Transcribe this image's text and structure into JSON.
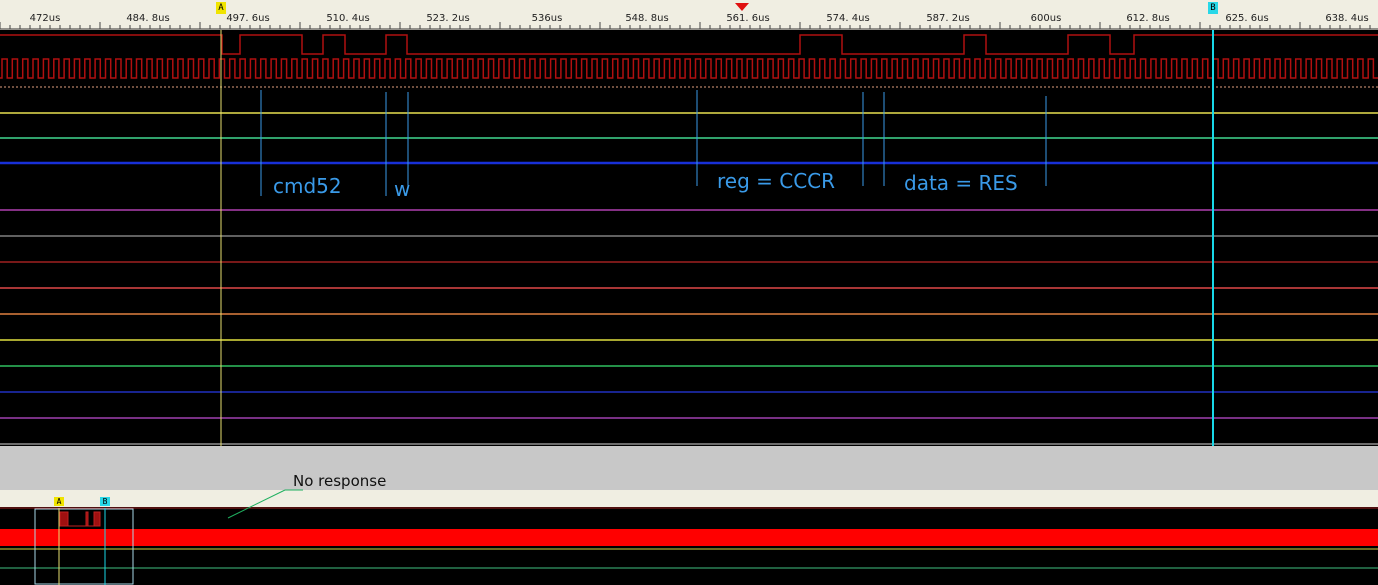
{
  "ruler": {
    "ticks": [
      "472us",
      "484. 8us",
      "497. 6us",
      "510. 4us",
      "523. 2us",
      "536us",
      "548. 8us",
      "561. 6us",
      "574. 4us",
      "587. 2us",
      "600us",
      "612. 8us",
      "625. 6us",
      "638. 4us"
    ]
  },
  "markers": {
    "a_label": "A",
    "b_label": "B"
  },
  "annotations": {
    "cmd": "cmd52",
    "rw": "w",
    "reg": "reg = CCCR",
    "data": "data = RES"
  },
  "callout": {
    "text": "No response"
  },
  "colors": {
    "cursor_a": "#e8e070",
    "cursor_b": "#18d8e8",
    "signal_red": "#b01010",
    "annotation_blue": "#3a9ae8",
    "channel_lines": [
      "#e8e050",
      "#40d890",
      "#1020c8",
      "#b040b0",
      "#808080",
      "#a02020",
      "#e04848",
      "#e08040",
      "#e0e040",
      "#30c060",
      "#2030c0",
      "#a040b0"
    ]
  }
}
